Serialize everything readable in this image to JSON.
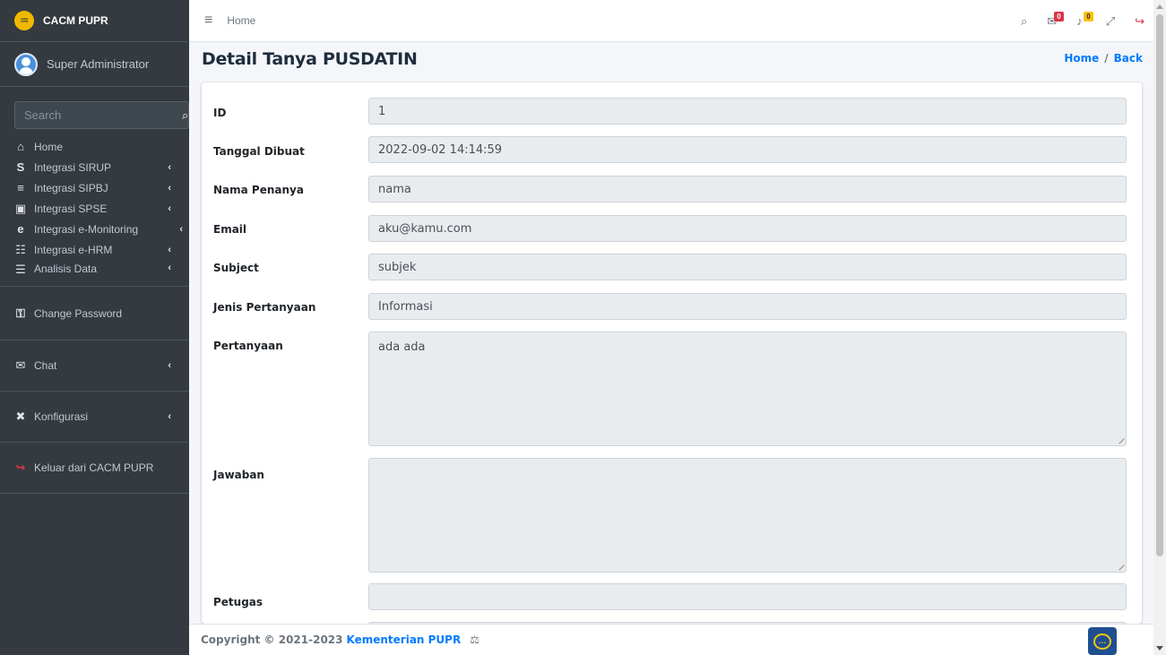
{
  "brand": {
    "name": "CACM PUPR",
    "logo_glyph": "♒"
  },
  "user": {
    "name": "Super Administrator"
  },
  "sidebar": {
    "search_placeholder": "Search",
    "items": [
      {
        "label": "Home",
        "icon": "home-icon",
        "glyph": "⌂",
        "arrow": ""
      },
      {
        "label": "Integrasi SIRUP",
        "icon": "dollar-icon",
        "glyph": "S",
        "arrow": "‹"
      },
      {
        "label": "Integrasi SIPBJ",
        "icon": "cart-icon",
        "glyph": "≡",
        "arrow": "‹"
      },
      {
        "label": "Integrasi SPSE",
        "icon": "building-icon",
        "glyph": "▣",
        "arrow": "‹"
      },
      {
        "label": "Integrasi e-Monitoring",
        "icon": "edge-icon",
        "glyph": "e",
        "arrow": "‹"
      },
      {
        "label": "Integrasi e-HRM",
        "icon": "users-icon",
        "glyph": "☷",
        "arrow": "‹"
      },
      {
        "label": "Analisis Data",
        "icon": "database-icon",
        "glyph": "☰",
        "arrow": "‹"
      }
    ],
    "change_password": "Change Password",
    "chat": "Chat",
    "konfigurasi": "Konfigurasi",
    "keluar": "Keluar dari CACM PUPR",
    "arrow": "‹"
  },
  "topbar": {
    "home_label": "Home",
    "hamburger_glyph": "≡",
    "search_glyph": "⌕",
    "chat_badge": "0",
    "notif_badge": "0",
    "chat_glyph": "✉",
    "notif_glyph": "♪",
    "expand_glyph": "⤢",
    "logout_glyph": "↪",
    "badge_colors": {
      "chat": "#dc3545",
      "notif": "#ffc107"
    }
  },
  "page": {
    "title": "Detail Tanya PUSDATIN",
    "breadcrumb_home": "Home",
    "breadcrumb_sep": "/",
    "breadcrumb_back": "Back"
  },
  "fields": {
    "id": {
      "label": "ID",
      "value": "1"
    },
    "tanggal": {
      "label": "Tanggal Dibuat",
      "value": "2022-09-02 14:14:59"
    },
    "nama": {
      "label": "Nama Penanya",
      "value": "nama"
    },
    "email": {
      "label": "Email",
      "value": "aku@kamu.com"
    },
    "subject": {
      "label": "Subject",
      "value": "subjek"
    },
    "jenis": {
      "label": "Jenis Pertanyaan",
      "value": "Informasi"
    },
    "pertanyaan": {
      "label": "Pertanyaan",
      "value": "ada ada"
    },
    "jawaban": {
      "label": "Jawaban",
      "value": ""
    },
    "petugas": {
      "label": "Petugas",
      "value": ""
    }
  },
  "footer": {
    "copyright": "Copyright © 2021-2023",
    "org": "Kementerian PUPR",
    "icon_glyph": "⚖"
  },
  "colors": {
    "sidebar_bg": "#343a40",
    "accent": "#007bff",
    "logout": "#dc3545"
  }
}
